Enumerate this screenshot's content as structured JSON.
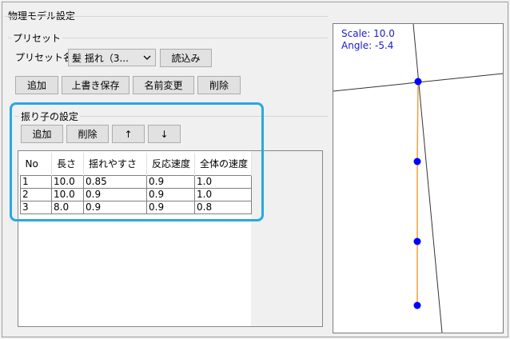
{
  "window": {
    "title": "物理モデル設定"
  },
  "preset": {
    "group_title": "プリセット",
    "name_label": "プリセット名：",
    "selected": "髪  揺れ（3...",
    "load_button": "読込み",
    "buttons": {
      "add": "追加",
      "overwrite": "上書き保存",
      "rename": "名前変更",
      "delete": "削除"
    }
  },
  "pendulum": {
    "group_title": "振り子の設定",
    "buttons": {
      "add": "追加",
      "delete": "削除",
      "up": "↑",
      "down": "↓"
    },
    "columns": [
      "No",
      "長さ",
      "揺れやすさ",
      "反応速度",
      "全体の速度"
    ],
    "rows": [
      [
        "1",
        "10.0",
        "0.85",
        "0.9",
        "1.0"
      ],
      [
        "2",
        "10.0",
        "0.9",
        "0.9",
        "1.0"
      ],
      [
        "3",
        "8.0",
        "0.9",
        "0.9",
        "0.8"
      ]
    ]
  },
  "preview": {
    "scale_text": "Scale: 10.0",
    "angle_text": "Angle: -5.4",
    "colors": {
      "node": "#0000ff",
      "chain": "#f0a040",
      "axis": "#333333",
      "text": "#1a1acc"
    }
  },
  "colors": {
    "highlight": "#29a8df"
  }
}
